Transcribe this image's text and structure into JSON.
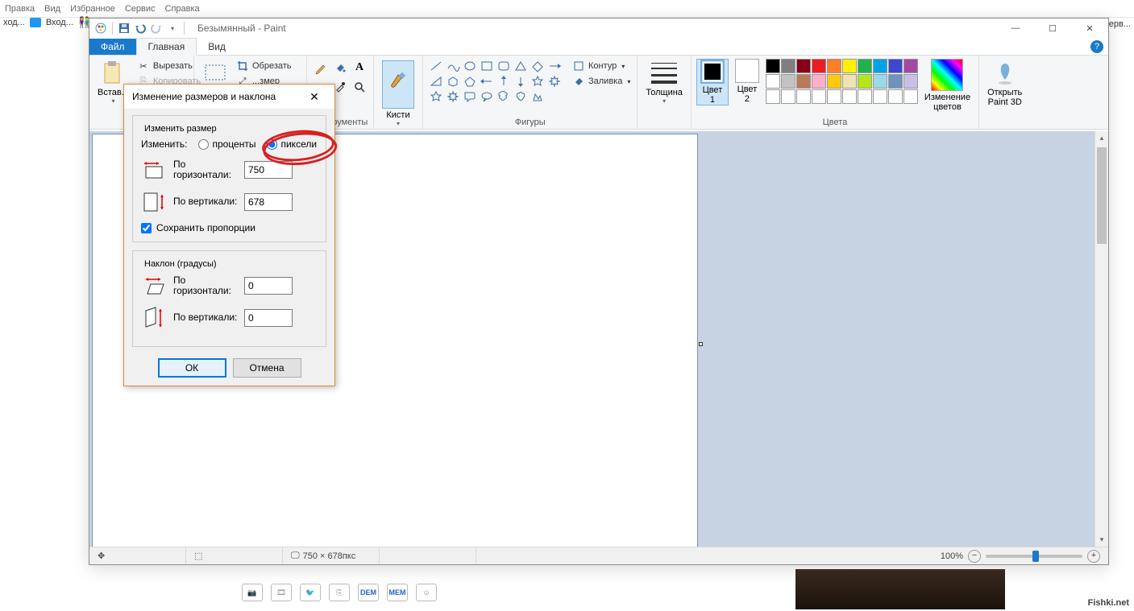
{
  "bg": {
    "menu": [
      "Правка",
      "Вид",
      "Избранное",
      "Сервис",
      "Справка"
    ],
    "task1": "ход...",
    "task2": "Вход...",
    "right": "Серв..."
  },
  "title": "Безымянный - Paint",
  "tabs": {
    "file": "Файл",
    "home": "Главная",
    "view": "Вид"
  },
  "ribbon": {
    "clipboard": {
      "paste": "Встав...",
      "cut": "Вырезать",
      "copy": "Копировать"
    },
    "image": {
      "select": "...",
      "crop": "Обрезать",
      "resize": "...змер",
      "rotate": "..."
    },
    "tools_label": "Инструменты",
    "brush": "Кисти",
    "shapes_label": "Фигуры",
    "outline": "Контур",
    "fill": "Заливка",
    "thickness": "Толщина",
    "color1": "Цвет\n1",
    "color2": "Цвет\n2",
    "editcolors": "Изменение\nцветов",
    "open3d": "Открыть\nPaint 3D",
    "colors_label": "Цвета"
  },
  "palette_row1": [
    "#000000",
    "#7f7f7f",
    "#880015",
    "#ed1c24",
    "#ff7f27",
    "#fff200",
    "#22b14c",
    "#00a2e8",
    "#3f48cc",
    "#a349a4"
  ],
  "palette_row2": [
    "#ffffff",
    "#c3c3c3",
    "#b97a57",
    "#ffaec9",
    "#ffc90e",
    "#efe4b0",
    "#b5e61d",
    "#99d9ea",
    "#7092be",
    "#c8bfe7"
  ],
  "palette_row3": [
    "#ffffff",
    "#ffffff",
    "#ffffff",
    "#ffffff",
    "#ffffff",
    "#ffffff",
    "#ffffff",
    "#ffffff",
    "#ffffff",
    "#ffffff"
  ],
  "dialog": {
    "title": "Изменение размеров и наклона",
    "resize_legend": "Изменить размер",
    "by_label": "Изменить:",
    "percent": "проценты",
    "pixels": "пиксели",
    "horiz": "По\nгоризонтали:",
    "vert": "По вертикали:",
    "h_val": "750",
    "v_val": "678",
    "keep": "Сохранить пропорции",
    "skew_legend": "Наклон (градусы)",
    "sh_val": "0",
    "sv_val": "0",
    "ok": "ОК",
    "cancel": "Отмена"
  },
  "status": {
    "dims": "750 × 678пкс",
    "zoom": "100%"
  },
  "overlay": {
    "dem": "DEM",
    "mem": "MEM"
  },
  "watermark": "Fishki.net"
}
